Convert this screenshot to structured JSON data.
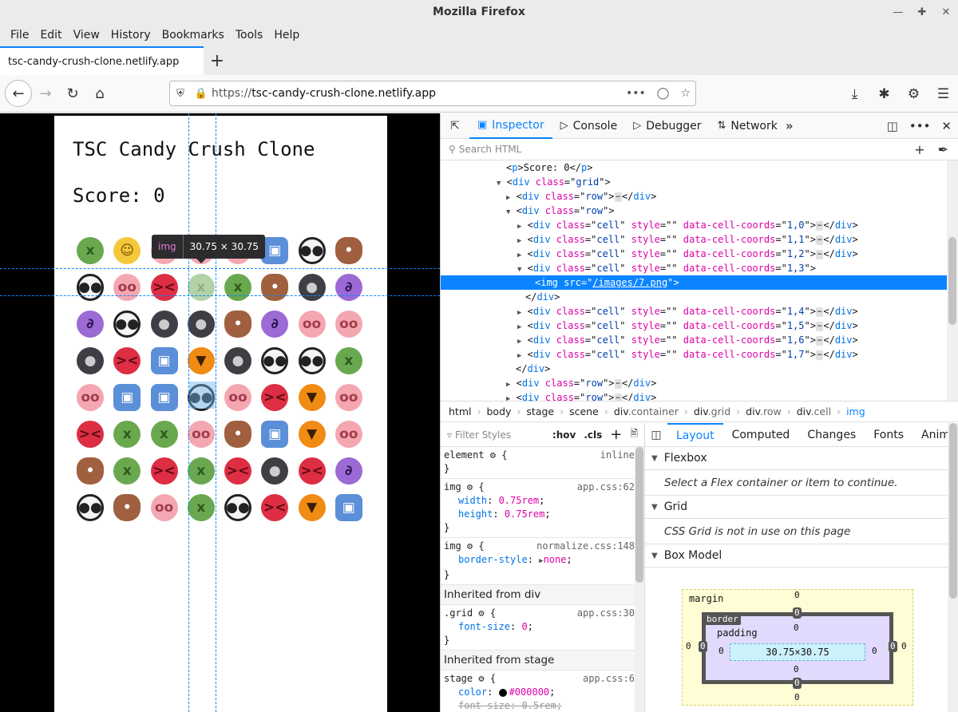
{
  "window": {
    "title": "Mozilla Firefox"
  },
  "menu": [
    "File",
    "Edit",
    "View",
    "History",
    "Bookmarks",
    "Tools",
    "Help"
  ],
  "tab": {
    "title": "tsc-candy-crush-clone.netlify.app"
  },
  "url": {
    "protocol": "https://",
    "host": "tsc-candy-crush-clone.netlify.app"
  },
  "page": {
    "title": "TSC Candy Crush Clone",
    "score_label": "Score: 0",
    "grid": [
      [
        "sick",
        "smile",
        "pig",
        "pig",
        "pig",
        "robot",
        "panda",
        "poop"
      ],
      [
        "panda",
        "pig",
        "angry",
        "sick",
        "sick",
        "poop",
        "gorilla",
        "devil"
      ],
      [
        "devil",
        "panda",
        "gorilla",
        "gorilla",
        "poop",
        "devil",
        "pig",
        "pig"
      ],
      [
        "gorilla",
        "angry",
        "robot",
        "pumpkin",
        "gorilla",
        "panda",
        "panda",
        "sick"
      ],
      [
        "pig",
        "robot",
        "robot",
        "panda",
        "pig",
        "angry",
        "pumpkin",
        "pig"
      ],
      [
        "angry",
        "sick",
        "sick",
        "pig",
        "poop",
        "robot",
        "pumpkin",
        "pig"
      ],
      [
        "poop",
        "sick",
        "angry",
        "sick",
        "angry",
        "gorilla",
        "angry",
        "devil"
      ],
      [
        "panda",
        "poop",
        "pig",
        "sick",
        "panda",
        "angry",
        "pumpkin",
        "robot"
      ]
    ],
    "selected_cell": {
      "row": 1,
      "col": 3
    }
  },
  "highlighter": {
    "tag": "img",
    "dims": "30.75 × 30.75"
  },
  "devtools": {
    "tabs": [
      "Inspector",
      "Console",
      "Debugger",
      "Network"
    ],
    "active_tab": "Inspector",
    "search_placeholder": "Search HTML",
    "breadcrumbs": [
      {
        "tag": "html",
        "cls": ""
      },
      {
        "tag": "body",
        "cls": ""
      },
      {
        "tag": "stage",
        "cls": ""
      },
      {
        "tag": "scene",
        "cls": ""
      },
      {
        "tag": "div",
        "cls": ".container"
      },
      {
        "tag": "div",
        "cls": ".grid"
      },
      {
        "tag": "div",
        "cls": ".row"
      },
      {
        "tag": "div",
        "cls": ".cell"
      },
      {
        "tag": "img",
        "cls": ""
      }
    ],
    "rules_filter_placeholder": "Filter Styles",
    "rules_hov": ":hov",
    "rules_cls": ".cls",
    "layout_tabs": [
      "Layout",
      "Computed",
      "Changes",
      "Fonts",
      "Anim"
    ],
    "flexbox_title": "Flexbox",
    "flexbox_msg": "Select a Flex container or item to continue.",
    "grid_title": "Grid",
    "grid_msg": "CSS Grid is not in use on this page",
    "boxmodel_title": "Box Model",
    "boxmodel": {
      "margin_label": "margin",
      "border_label": "border",
      "padding_label": "padding",
      "content": "30.75×30.75",
      "zero": "0"
    }
  }
}
